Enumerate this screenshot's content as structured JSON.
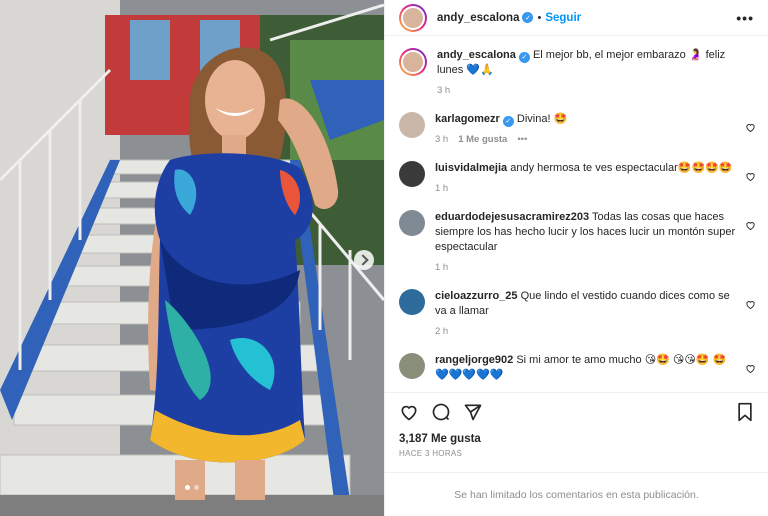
{
  "colors": {
    "accent": "#0095f6",
    "verified": "#3897f0",
    "muted": "#8e8e8e",
    "heart": "#262626"
  },
  "post": {
    "author": "andy_escalona",
    "follow_label": "Seguir",
    "more_label": "•••",
    "caption_user": "andy_escalona",
    "caption_text": "El mejor bb, el mejor embarazo 🤰 feliz lunes 💙🙏",
    "caption_time": "3 h",
    "likes": "3,187 Me gusta",
    "posted": "HACE 3 HORAS",
    "limited_notice": "Se han limitado los comentarios en esta publicación.",
    "carousel_page": 1,
    "carousel_pages": 2
  },
  "comments": [
    {
      "user": "karlagomezr",
      "verified": true,
      "text": "Divina! 🤩",
      "time": "3 h",
      "likes": "1 Me gusta",
      "more": "•••",
      "avatar_color": "#c9b8aa"
    },
    {
      "user": "luisvidalmejia",
      "verified": false,
      "text": "andy hermosa te ves espectacular🤩🤩🤩🤩",
      "time": "1 h",
      "likes": "",
      "more": "",
      "avatar_color": "#3a3a3a"
    },
    {
      "user": "eduardodejesusacramirez203",
      "verified": false,
      "text": "Todas las cosas que haces siempre los has hecho lucir y los haces lucir un montón super espectacular",
      "time": "1 h",
      "likes": "",
      "more": "",
      "avatar_color": "#7f8a94"
    },
    {
      "user": "cieloazzurro_25",
      "verified": false,
      "text": "Que lindo el vestido cuando dices como se va a llamar",
      "time": "2 h",
      "likes": "",
      "more": "",
      "avatar_color": "#2c6b9a"
    },
    {
      "user": "rangeljorge902",
      "verified": false,
      "text": "Si mi amor te amo mucho 😘🤩 😘😘🤩 🤩💙💙💙💙💙",
      "time": "",
      "likes": "",
      "more": "",
      "avatar_color": "#8a8f7c"
    }
  ]
}
